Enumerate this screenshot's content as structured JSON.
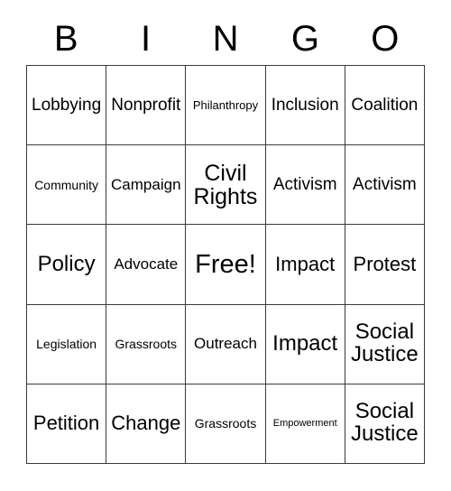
{
  "card": {
    "title": "BINGO",
    "header_letters": [
      "B",
      "I",
      "N",
      "G",
      "O"
    ],
    "free_space_label": "Free!",
    "colors": {
      "background": "#ffffff",
      "grid_line": "#3a3a3a",
      "text": "#000000"
    },
    "grid": {
      "columns": 5,
      "rows": 5,
      "cells": [
        {
          "text": "Lobbying",
          "size": "fs-l"
        },
        {
          "text": "Nonprofit",
          "size": "fs-l"
        },
        {
          "text": "Philanthropy",
          "size": "fs-xs"
        },
        {
          "text": "Inclusion",
          "size": "fs-l"
        },
        {
          "text": "Coalition",
          "size": "fs-l"
        },
        {
          "text": "Community",
          "size": "fs-s"
        },
        {
          "text": "Campaign",
          "size": "fs-m"
        },
        {
          "text": "Civil Rights",
          "size": "fs-3xl"
        },
        {
          "text": "Activism",
          "size": "fs-l"
        },
        {
          "text": "Activism",
          "size": "fs-l"
        },
        {
          "text": "Policy",
          "size": "fs-xxl"
        },
        {
          "text": "Advocate",
          "size": "fs-m"
        },
        {
          "text": "Free!",
          "size": "fs-free"
        },
        {
          "text": "Impact",
          "size": "fs-xl"
        },
        {
          "text": "Protest",
          "size": "fs-xl"
        },
        {
          "text": "Legislation",
          "size": "fs-s"
        },
        {
          "text": "Grassroots",
          "size": "fs-s"
        },
        {
          "text": "Outreach",
          "size": "fs-m"
        },
        {
          "text": "Impact",
          "size": "fs-xxl"
        },
        {
          "text": "Social Justice",
          "size": "fs-xxl"
        },
        {
          "text": "Petition",
          "size": "fs-xl"
        },
        {
          "text": "Change",
          "size": "fs-xl"
        },
        {
          "text": "Grassroots",
          "size": "fs-s"
        },
        {
          "text": "Empowerment",
          "size": "fs-xxs"
        },
        {
          "text": "Social Justice",
          "size": "fs-xxl"
        }
      ]
    }
  }
}
